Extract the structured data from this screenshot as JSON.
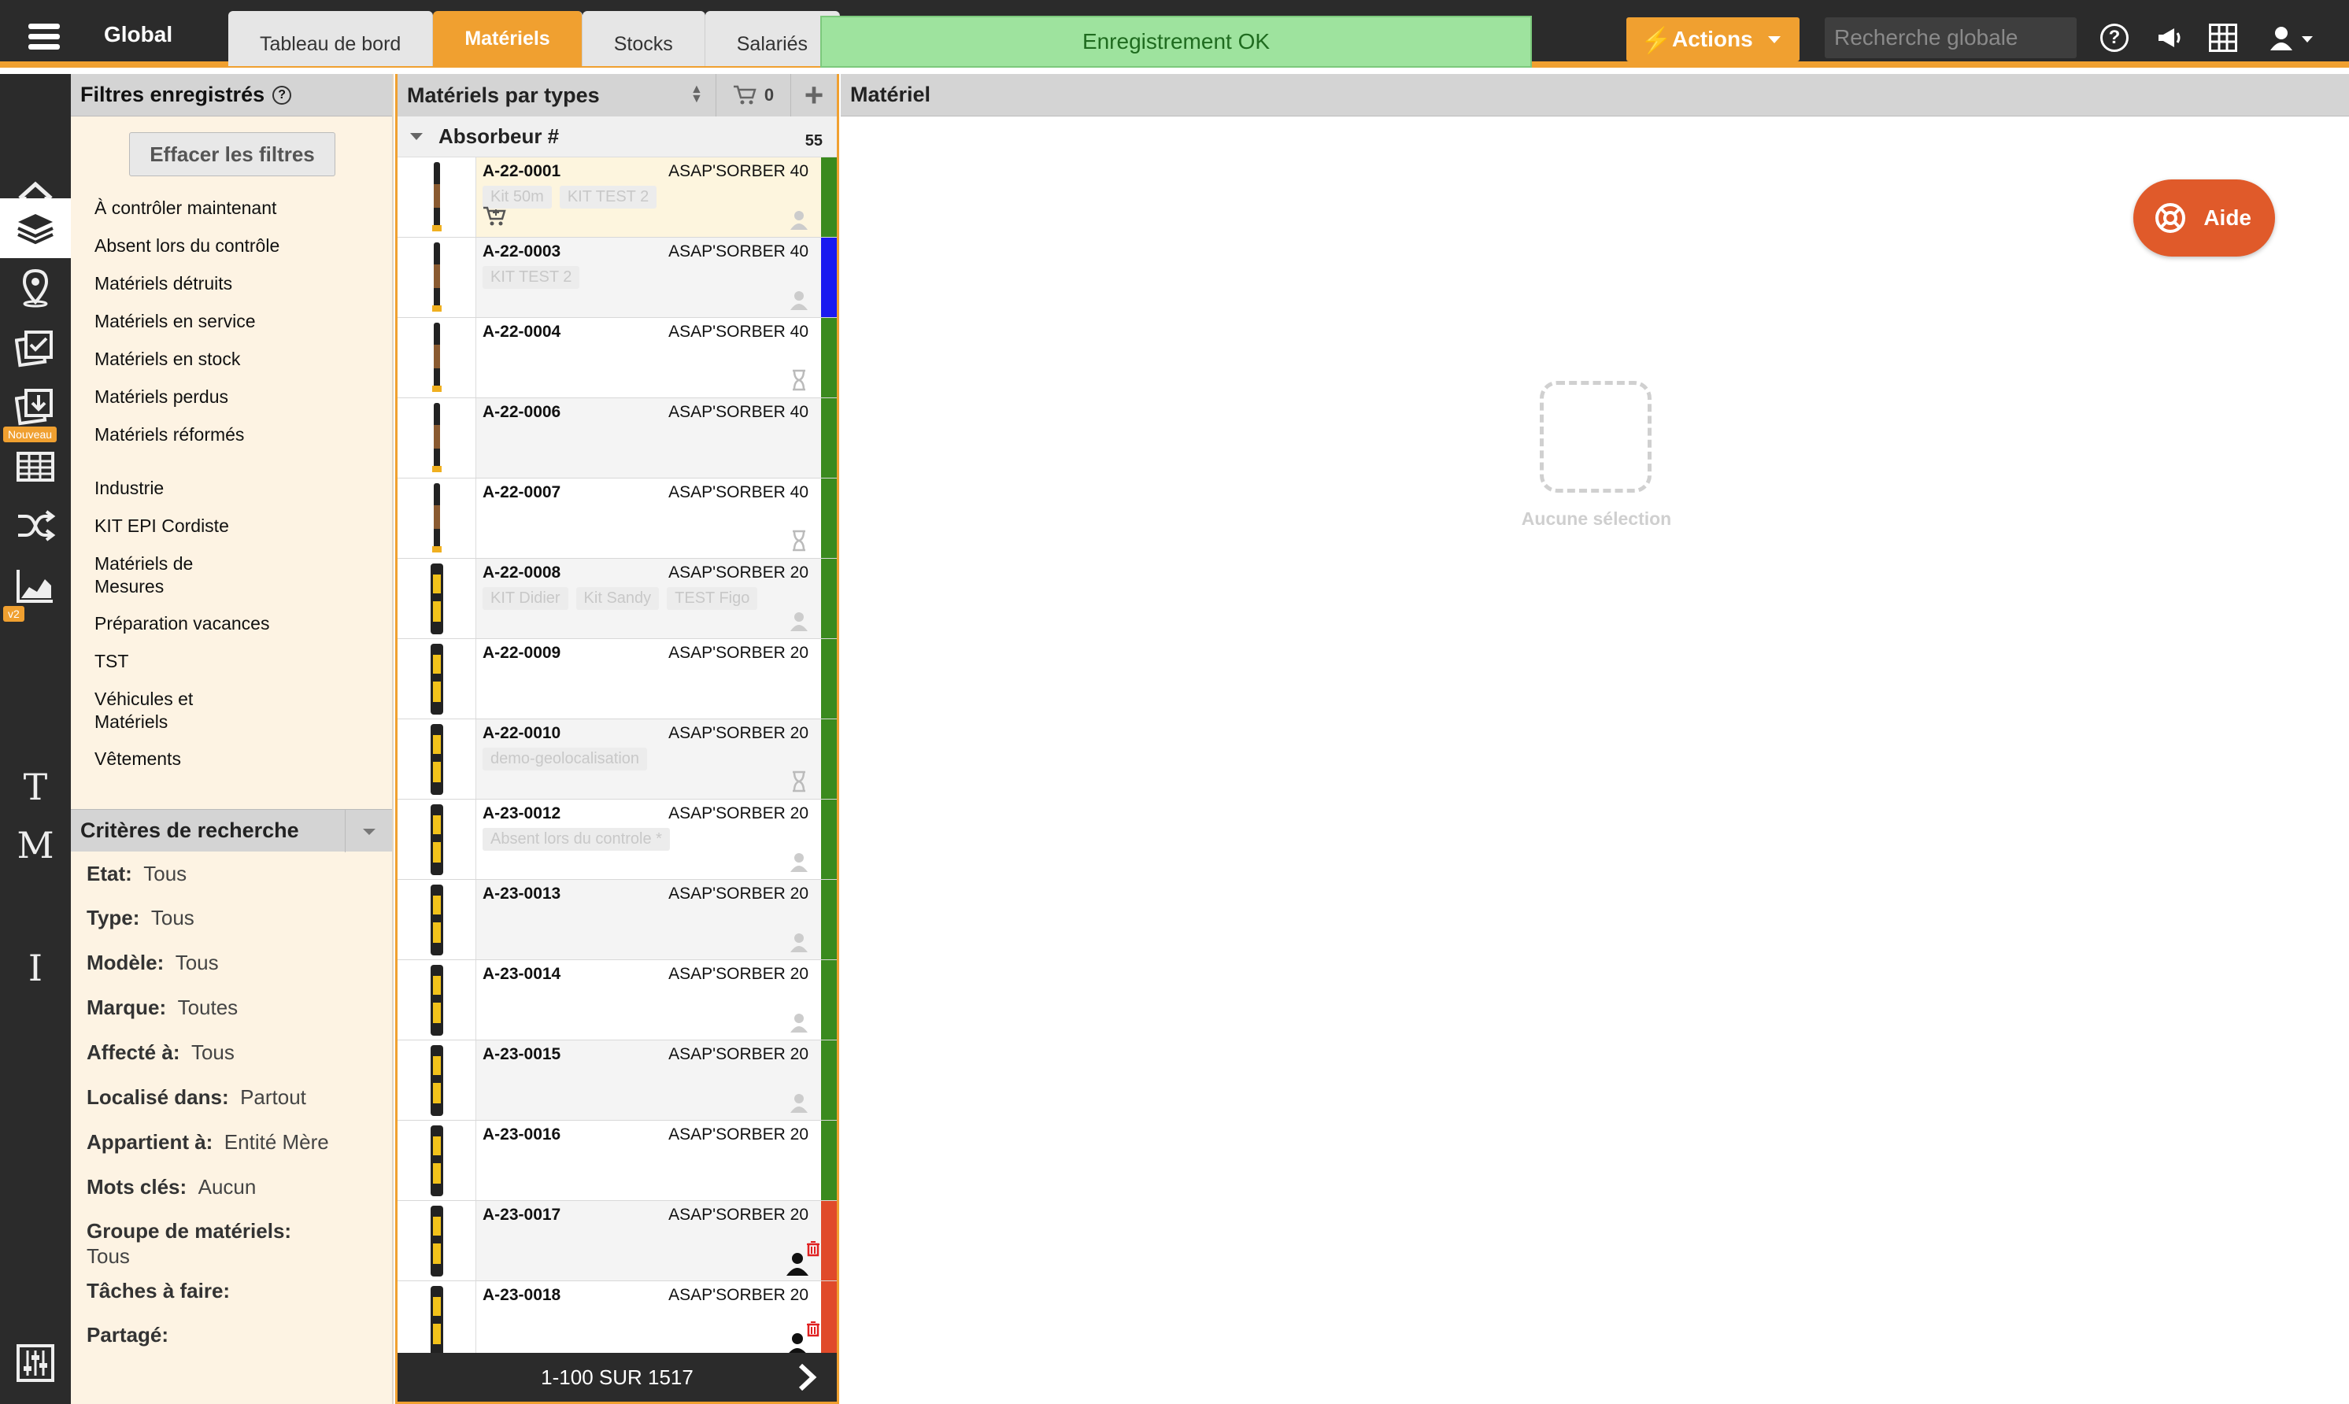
{
  "topbar": {
    "title": "Global",
    "tabs": [
      {
        "label": "Tableau de bord",
        "active": false
      },
      {
        "label": "Matériels",
        "active": true
      },
      {
        "label": "Stocks",
        "active": false
      },
      {
        "label": "Salariés",
        "active": false
      }
    ],
    "toast": "Enregistrement OK",
    "actions_label": "Actions",
    "search_placeholder": "Recherche globale",
    "accent_color": "#f0a030"
  },
  "leftnav": {
    "items": [
      "home-icon",
      "layers-icon",
      "map-pin-icon",
      "checklist-icon",
      "download-icon",
      "table-icon",
      "shuffle-icon",
      "chart-icon"
    ],
    "badge_new": "Nouveau",
    "badge_v2": "v2",
    "letters": [
      "T",
      "M",
      "I"
    ]
  },
  "filters": {
    "header": "Filtres enregistrés",
    "clear_label": "Effacer les filtres",
    "links_group1": [
      "À contrôler maintenant",
      "Absent lors du contrôle",
      "Matériels détruits",
      "Matériels en service",
      "Matériels en stock",
      "Matériels perdus",
      "Matériels réformés"
    ],
    "links_group2": [
      "Industrie",
      "KIT EPI Cordiste",
      "Matériels de Mesures",
      "Préparation vacances",
      "TST",
      "Véhicules et Matériels",
      "Vêtements"
    ]
  },
  "criteria": {
    "header": "Critères de recherche",
    "items": [
      {
        "label": "Etat:",
        "value": "Tous"
      },
      {
        "label": "Type:",
        "value": "Tous"
      },
      {
        "label": "Modèle:",
        "value": "Tous"
      },
      {
        "label": "Marque:",
        "value": "Toutes"
      },
      {
        "label": "Affecté à:",
        "value": "Tous"
      },
      {
        "label": "Localisé dans:",
        "value": "Partout"
      },
      {
        "label": "Appartient à:",
        "value": "Entité Mère"
      },
      {
        "label": "Mots clés:",
        "value": "Aucun"
      },
      {
        "label": "Groupe de matériels:",
        "value": "Tous"
      },
      {
        "label": "Tâches à faire:",
        "value": ""
      },
      {
        "label": "Partagé:",
        "value": ""
      }
    ]
  },
  "list": {
    "header": "Matériels par types",
    "cart_count": "0",
    "group_name": "Absorbeur #",
    "group_count": "55",
    "pager": "1-100 SUR 1517",
    "rows": [
      {
        "code": "A-22-0001",
        "model": "ASAP'SORBER 40",
        "tags": [
          "Kit 50m",
          "KIT TEST 2"
        ],
        "status": "#3a8a1e",
        "icon": "person",
        "cart": true,
        "style": "highlight",
        "thumb": "dark"
      },
      {
        "code": "A-22-0003",
        "model": "ASAP'SORBER 40",
        "tags": [
          "KIT TEST 2"
        ],
        "status": "#1a1af0",
        "icon": "person",
        "cart": false,
        "style": "alt",
        "thumb": "dark"
      },
      {
        "code": "A-22-0004",
        "model": "ASAP'SORBER 40",
        "tags": [],
        "status": "#3a8a1e",
        "icon": "hourglass",
        "cart": false,
        "style": "",
        "thumb": "dark"
      },
      {
        "code": "A-22-0006",
        "model": "ASAP'SORBER 40",
        "tags": [],
        "status": "#3a8a1e",
        "icon": "",
        "cart": false,
        "style": "alt",
        "thumb": "dark"
      },
      {
        "code": "A-22-0007",
        "model": "ASAP'SORBER 40",
        "tags": [],
        "status": "#3a8a1e",
        "icon": "hourglass",
        "cart": false,
        "style": "",
        "thumb": "dark"
      },
      {
        "code": "A-22-0008",
        "model": "ASAP'SORBER 20",
        "tags": [
          "KIT Didier",
          "Kit Sandy",
          "TEST Figo"
        ],
        "status": "#3a8a1e",
        "icon": "person",
        "cart": false,
        "style": "alt",
        "thumb": "yellow"
      },
      {
        "code": "A-22-0009",
        "model": "ASAP'SORBER 20",
        "tags": [],
        "status": "#3a8a1e",
        "icon": "",
        "cart": false,
        "style": "",
        "thumb": "yellow"
      },
      {
        "code": "A-22-0010",
        "model": "ASAP'SORBER 20",
        "tags": [
          "demo-geolocalisation"
        ],
        "status": "#3a8a1e",
        "icon": "hourglass",
        "cart": false,
        "style": "alt",
        "thumb": "yellow"
      },
      {
        "code": "A-23-0012",
        "model": "ASAP'SORBER 20",
        "tags": [
          "Absent lors du controle *"
        ],
        "status": "#3a8a1e",
        "icon": "person",
        "cart": false,
        "style": "",
        "thumb": "yellow"
      },
      {
        "code": "A-23-0013",
        "model": "ASAP'SORBER 20",
        "tags": [],
        "status": "#3a8a1e",
        "icon": "person",
        "cart": false,
        "style": "alt",
        "thumb": "yellow"
      },
      {
        "code": "A-23-0014",
        "model": "ASAP'SORBER 20",
        "tags": [],
        "status": "#3a8a1e",
        "icon": "person",
        "cart": false,
        "style": "",
        "thumb": "yellow"
      },
      {
        "code": "A-23-0015",
        "model": "ASAP'SORBER 20",
        "tags": [],
        "status": "#3a8a1e",
        "icon": "person",
        "cart": false,
        "style": "alt",
        "thumb": "yellow"
      },
      {
        "code": "A-23-0016",
        "model": "ASAP'SORBER 20",
        "tags": [],
        "status": "#3a8a1e",
        "icon": "",
        "cart": false,
        "style": "",
        "thumb": "yellow"
      },
      {
        "code": "A-23-0017",
        "model": "ASAP'SORBER 20",
        "tags": [],
        "status": "#e04a2a",
        "icon": "person-trash",
        "cart": false,
        "style": "alt",
        "thumb": "yellow"
      },
      {
        "code": "A-23-0018",
        "model": "ASAP'SORBER 20",
        "tags": [],
        "status": "#e04a2a",
        "icon": "person-trash",
        "cart": false,
        "style": "",
        "thumb": "yellow"
      }
    ]
  },
  "detail": {
    "header": "Matériel",
    "help_label": "Aide",
    "empty_label": "Aucune sélection"
  }
}
